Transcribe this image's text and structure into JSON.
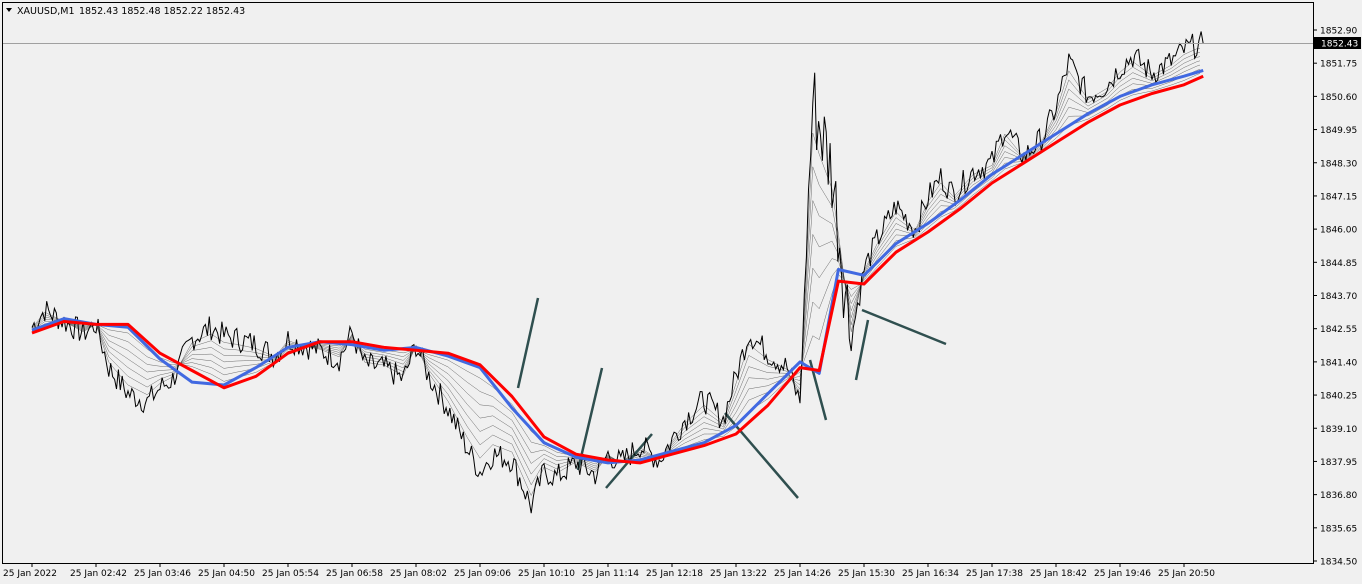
{
  "header": {
    "symbol": "XAUUSD,M1",
    "ohlc": "1852.43 1852.48 1852.22 1852.43"
  },
  "price_tag": "1852.43",
  "colors": {
    "background": "#f0f0f0",
    "price_line": "#000000",
    "ma_fast": "#4169e1",
    "ma_slow": "#ff0000",
    "ribbon": "#000000",
    "trend_lines": "#2f4f4f",
    "bid_line": "#a0a0a0",
    "tag_bg": "#000000"
  },
  "chart_data": {
    "type": "line",
    "title": "XAUUSD,M1",
    "xlabel": "",
    "ylabel": "",
    "ylim": [
      1834.5,
      1853.5
    ],
    "y_ticks": [
      "1852.90",
      "1851.75",
      "1850.60",
      "1849.95",
      "1848.30",
      "1847.15",
      "1846.00",
      "1844.85",
      "1843.70",
      "1842.55",
      "1841.40",
      "1840.25",
      "1839.10",
      "1837.95",
      "1836.80",
      "1835.65",
      "1834.50"
    ],
    "x_ticks": [
      "25 Jan 2022",
      "25 Jan 02:42",
      "25 Jan 03:46",
      "25 Jan 04:50",
      "25 Jan 05:54",
      "25 Jan 06:58",
      "25 Jan 08:02",
      "25 Jan 09:06",
      "25 Jan 10:10",
      "25 Jan 11:14",
      "25 Jan 12:18",
      "25 Jan 13:22",
      "25 Jan 14:26",
      "25 Jan 15:30",
      "25 Jan 16:34",
      "25 Jan 17:38",
      "25 Jan 18:42",
      "25 Jan 19:46",
      "25 Jan 20:50"
    ],
    "grid": false,
    "current_price": 1852.43,
    "series": [
      {
        "name": "XAUUSD,M1",
        "x": [
          0,
          0.2,
          0.5,
          0.8,
          1,
          1.2,
          1.5,
          1.8,
          2,
          2.2,
          2.5,
          2.8,
          3,
          3.2,
          3.5,
          3.8,
          4,
          4.2,
          4.5,
          4.8,
          5,
          5.2,
          5.5,
          5.8,
          6,
          6.2,
          6.5,
          6.8,
          7,
          7.2,
          7.5,
          7.8,
          8,
          8.2,
          8.5,
          8.8,
          9,
          9.2,
          9.5,
          9.8,
          10,
          10.2,
          10.5,
          10.8,
          11,
          11.2,
          11.5,
          11.8,
          12,
          12.2,
          12.5,
          12.8,
          13,
          13.2,
          13.5,
          13.8,
          14,
          14.2,
          14.4,
          14.7,
          15,
          15.2,
          15.5,
          15.8,
          16,
          16.2,
          16.5,
          16.8,
          17,
          17.2,
          17.5,
          17.8,
          18,
          18.2,
          18.3
        ],
        "values": [
          1842.6,
          1843.2,
          1842.8,
          1842.4,
          1842.7,
          1841.2,
          1840.3,
          1840.0,
          1840.5,
          1840.8,
          1842.2,
          1842.6,
          1842.3,
          1842.2,
          1842.0,
          1841.6,
          1842.2,
          1842.0,
          1841.8,
          1841.5,
          1842.4,
          1841.3,
          1841.2,
          1840.8,
          1842.0,
          1840.9,
          1839.8,
          1838.4,
          1837.6,
          1838.2,
          1838.0,
          1836.4,
          1837.6,
          1837.4,
          1837.9,
          1837.5,
          1838.2,
          1837.9,
          1838.5,
          1838.0,
          1838.7,
          1839.4,
          1840.1,
          1839.4,
          1840.9,
          1842.4,
          1841.7,
          1841.2,
          1840.0,
          1850.5,
          1848.0,
          1842.2,
          1844.6,
          1845.6,
          1846.8,
          1846.0,
          1847.1,
          1847.8,
          1847.2,
          1848.0,
          1848.3,
          1849.5,
          1848.5,
          1849.2,
          1850.2,
          1851.8,
          1850.6,
          1851.0,
          1851.6,
          1852.0,
          1851.4,
          1851.8,
          1852.2,
          1852.4,
          1852.43
        ]
      },
      {
        "name": "",
        "x": [
          0,
          0.5,
          1,
          1.5,
          2,
          2.5,
          3,
          3.5,
          4,
          4.5,
          5,
          5.5,
          6,
          6.5,
          7,
          7.5,
          8,
          8.5,
          9,
          9.5,
          10,
          10.5,
          11,
          11.5,
          12,
          12.3,
          12.6,
          13,
          13.5,
          14,
          14.5,
          15,
          15.5,
          16,
          16.5,
          17,
          17.5,
          18,
          18.3
        ],
        "values": [
          1842.5,
          1842.9,
          1842.7,
          1842.6,
          1841.5,
          1840.7,
          1840.6,
          1841.2,
          1841.9,
          1842.1,
          1842.0,
          1841.8,
          1841.9,
          1841.6,
          1841.2,
          1839.8,
          1838.6,
          1838.1,
          1837.9,
          1838.0,
          1838.3,
          1838.6,
          1839.2,
          1840.3,
          1841.4,
          1841.0,
          1844.6,
          1844.4,
          1845.5,
          1846.2,
          1847.0,
          1847.9,
          1848.6,
          1849.3,
          1850.0,
          1850.6,
          1851.0,
          1851.3,
          1851.5
        ]
      },
      {
        "name": "",
        "x": [
          0,
          0.5,
          1,
          1.5,
          2,
          2.5,
          3,
          3.5,
          4,
          4.5,
          5,
          5.5,
          6,
          6.5,
          7,
          7.5,
          8,
          8.5,
          9,
          9.5,
          10,
          10.5,
          11,
          11.5,
          12,
          12.3,
          12.6,
          13,
          13.5,
          14,
          14.5,
          15,
          15.5,
          16,
          16.5,
          17,
          17.5,
          18,
          18.3
        ],
        "values": [
          1842.4,
          1842.8,
          1842.7,
          1842.7,
          1841.7,
          1841.1,
          1840.5,
          1840.9,
          1841.7,
          1842.1,
          1842.1,
          1841.9,
          1841.8,
          1841.7,
          1841.3,
          1840.2,
          1838.8,
          1838.2,
          1838.0,
          1837.9,
          1838.2,
          1838.5,
          1838.9,
          1839.9,
          1841.2,
          1841.1,
          1844.2,
          1844.1,
          1845.2,
          1845.9,
          1846.7,
          1847.6,
          1848.3,
          1849.0,
          1849.7,
          1850.3,
          1850.7,
          1851.0,
          1851.3
        ]
      }
    ]
  }
}
